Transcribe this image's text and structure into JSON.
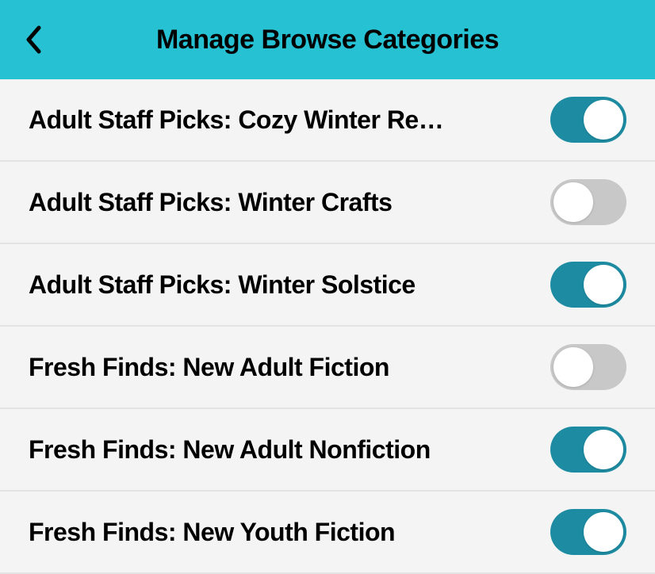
{
  "header": {
    "title": "Manage Browse Categories"
  },
  "categories": [
    {
      "label": "Adult Staff Picks: Cozy Winter Re…",
      "enabled": true
    },
    {
      "label": "Adult Staff Picks: Winter Crafts",
      "enabled": false
    },
    {
      "label": "Adult Staff Picks: Winter Solstice",
      "enabled": true
    },
    {
      "label": "Fresh Finds: New Adult Fiction",
      "enabled": false
    },
    {
      "label": "Fresh Finds: New Adult Nonfiction",
      "enabled": true
    },
    {
      "label": "Fresh Finds: New Youth Fiction",
      "enabled": true
    }
  ],
  "colors": {
    "headerBg": "#26c1d3",
    "toggleOn": "#1d8ca2",
    "toggleOff": "#c8c8c8"
  }
}
